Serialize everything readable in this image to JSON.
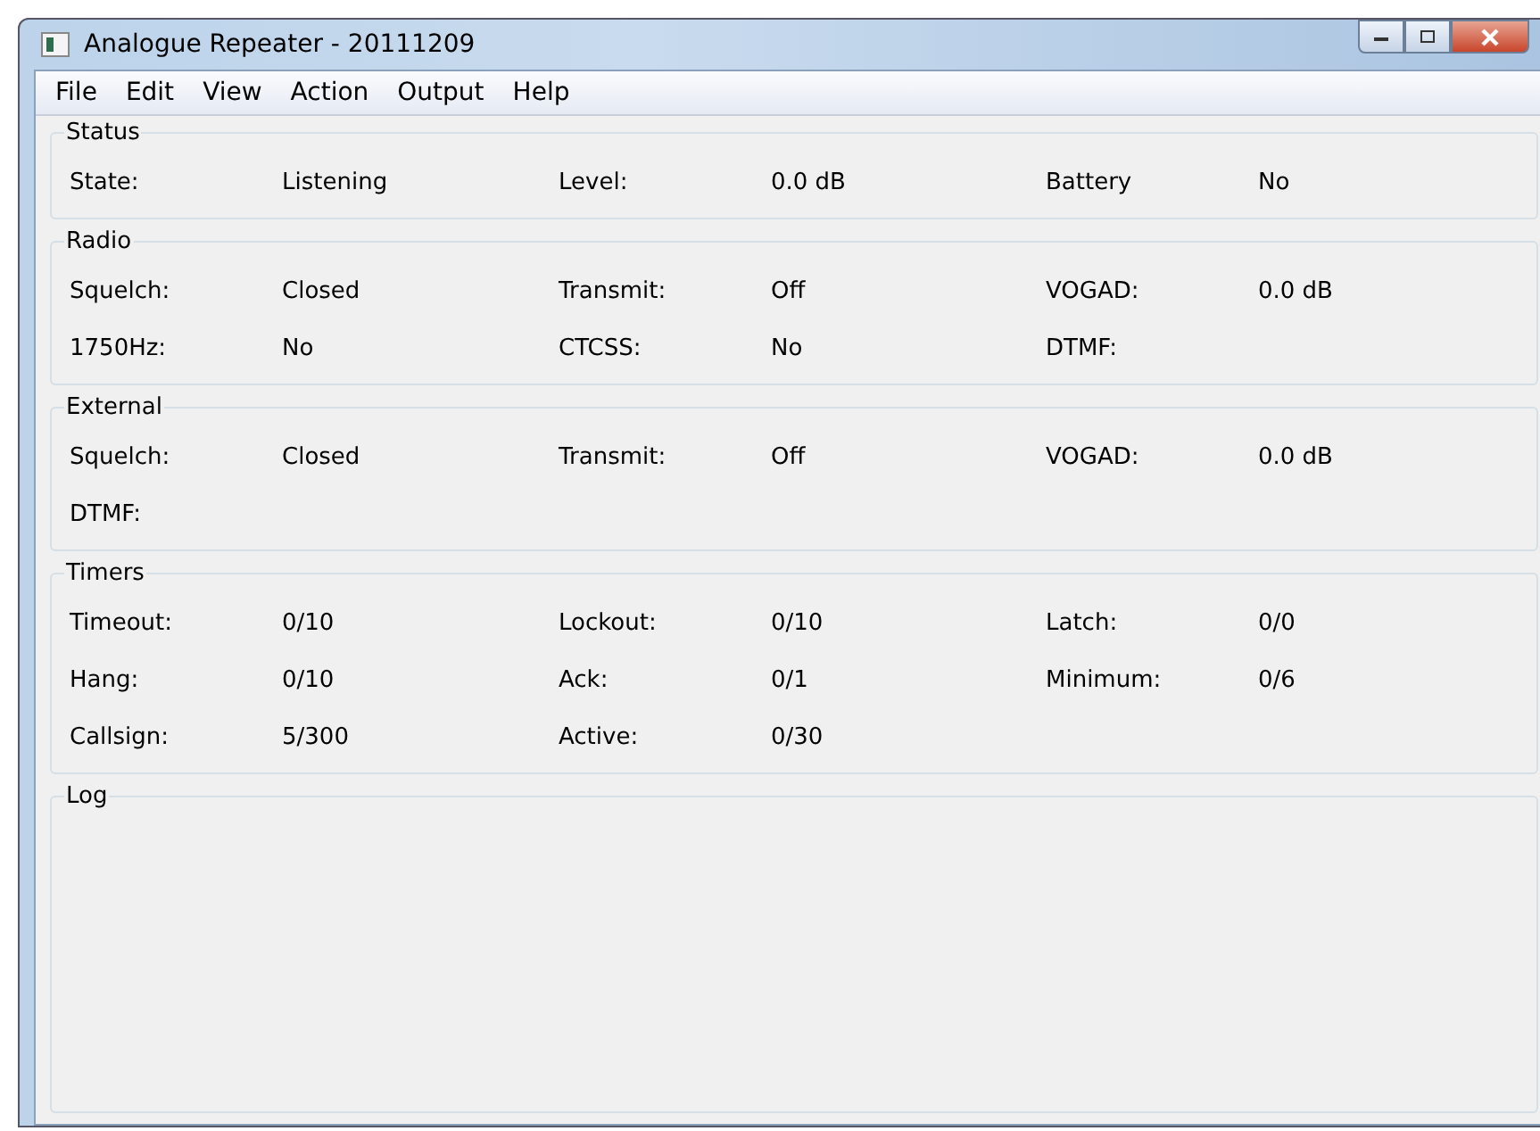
{
  "window": {
    "title": "Analogue Repeater - 20111209"
  },
  "menu": [
    "File",
    "Edit",
    "View",
    "Action",
    "Output",
    "Help"
  ],
  "groups": [
    {
      "title": "Status",
      "rows": [
        [
          {
            "label": "State:",
            "value": "Listening"
          },
          {
            "label": "Level:",
            "value": "0.0 dB"
          },
          {
            "label": "Battery",
            "value": "No"
          }
        ]
      ]
    },
    {
      "title": "Radio",
      "rows": [
        [
          {
            "label": "Squelch:",
            "value": "Closed"
          },
          {
            "label": "Transmit:",
            "value": "Off"
          },
          {
            "label": "VOGAD:",
            "value": "0.0 dB"
          }
        ],
        [
          {
            "label": "1750Hz:",
            "value": "No"
          },
          {
            "label": "CTCSS:",
            "value": "No"
          },
          {
            "label": "DTMF:"
          }
        ]
      ]
    },
    {
      "title": "External",
      "rows": [
        [
          {
            "label": "Squelch:",
            "value": "Closed"
          },
          {
            "label": "Transmit:",
            "value": "Off"
          },
          {
            "label": "VOGAD:",
            "value": "0.0 dB"
          }
        ],
        [
          {
            "label": "DTMF:"
          }
        ]
      ]
    },
    {
      "title": "Timers",
      "rows": [
        [
          {
            "label": "Timeout:",
            "value": "0/10"
          },
          {
            "label": "Lockout:",
            "value": "0/10"
          },
          {
            "label": "Latch:",
            "value": "0/0"
          }
        ],
        [
          {
            "label": "Hang:",
            "value": "0/10"
          },
          {
            "label": "Ack:",
            "value": "0/1"
          },
          {
            "label": "Minimum:",
            "value": "0/6"
          }
        ],
        [
          {
            "label": "Callsign:",
            "value": "5/300"
          },
          {
            "label": "Active:",
            "value": "0/30"
          }
        ]
      ]
    }
  ],
  "log": {
    "title": "Log"
  }
}
